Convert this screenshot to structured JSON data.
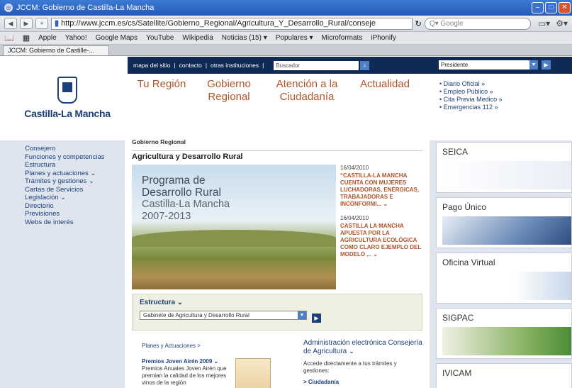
{
  "browser": {
    "window_title": "JCCM: Gobierno de Castilla-La Mancha",
    "url": "http://www.jccm.es/cs/Satellite/Gobierno_Regional/Agricultura_Y_Desarrollo_Rural/conseje",
    "search_placeholder": "Q▾ Google",
    "bookmarks": [
      "Apple",
      "Yahoo!",
      "Google Maps",
      "YouTube",
      "Wikipedia",
      "Noticias (15) ▾",
      "Populares ▾",
      "Microformats",
      "iPhonify"
    ],
    "tab_label": "JCCM: Gobierno de Castille-..."
  },
  "topbar": {
    "links": [
      "mapa del sitio",
      "|",
      "contacto",
      "|",
      "otras instituciones",
      "|"
    ],
    "search_placeholder": "Buscador",
    "president_select": "Presidente"
  },
  "logo": {
    "name": "Castilla-La Mancha"
  },
  "mainnav": {
    "items": [
      "Tu Región",
      "Gobierno Regional",
      "Atención a la Ciudadanía",
      "Actualidad"
    ]
  },
  "quicklinks": [
    "• Diario Oficial »",
    "• Empleo Público »",
    "• Cita Previa Medico »",
    "• Emergencias 112 »"
  ],
  "leftnav": [
    "Consejero",
    "Funciones y competencias",
    "Estructura",
    "Planes y actuaciones ⌄",
    "Trámites y gestiones ⌄",
    "Cartas de Servicios",
    "Legislación ⌄",
    "Directorio",
    "Previsiones",
    "Webs de interés"
  ],
  "breadcrumb": "Gobierno Regional",
  "section_title": "Agricultura y Desarrollo Rural",
  "hero": {
    "line1": "Programa de",
    "line2": "Desarrollo Rural",
    "line3": "Castilla-La Mancha",
    "line4": "2007-2013"
  },
  "news": [
    {
      "date": "16/04/2010",
      "headline": "“CASTILLA-LA MANCHA CUENTA CON MUJERES LUCHADORAS, ENÉRGICAS, TRABAJADORAS E INCONFORMI... ⌄"
    },
    {
      "date": "16/04/2010",
      "headline": "CASTILLA LA MANCHA APUESTA POR LA AGRICULTURA ECOLÓGICA COMO CLARO EJEMPLO DEL MODELO ... ⌄"
    }
  ],
  "estructura": {
    "label": "Estructura ⌄",
    "selected": "Gabinete de Agricultura y Desarrollo Rural"
  },
  "planes": {
    "heading": "Planes y Actuaciones >",
    "title": "Premios Joven Airén 2009 ⌄",
    "body": "Premios Anuales Joven Airén que premian la calidad de los mejores vinos de la región"
  },
  "admin": {
    "heading": "Administración electrónica Consejería de Agricultura ⌄",
    "body": "Accede directamente a tus trámites y gestiones:",
    "item": "> Ciudadanía"
  },
  "rightboxes": [
    "SEICA",
    "Pago Único",
    "Oficina Virtual",
    "SIGPAC",
    "IVICAM"
  ],
  "colors": {
    "navy": "#0e2a55",
    "accent": "#b0542a",
    "link": "#1d3f7a"
  }
}
